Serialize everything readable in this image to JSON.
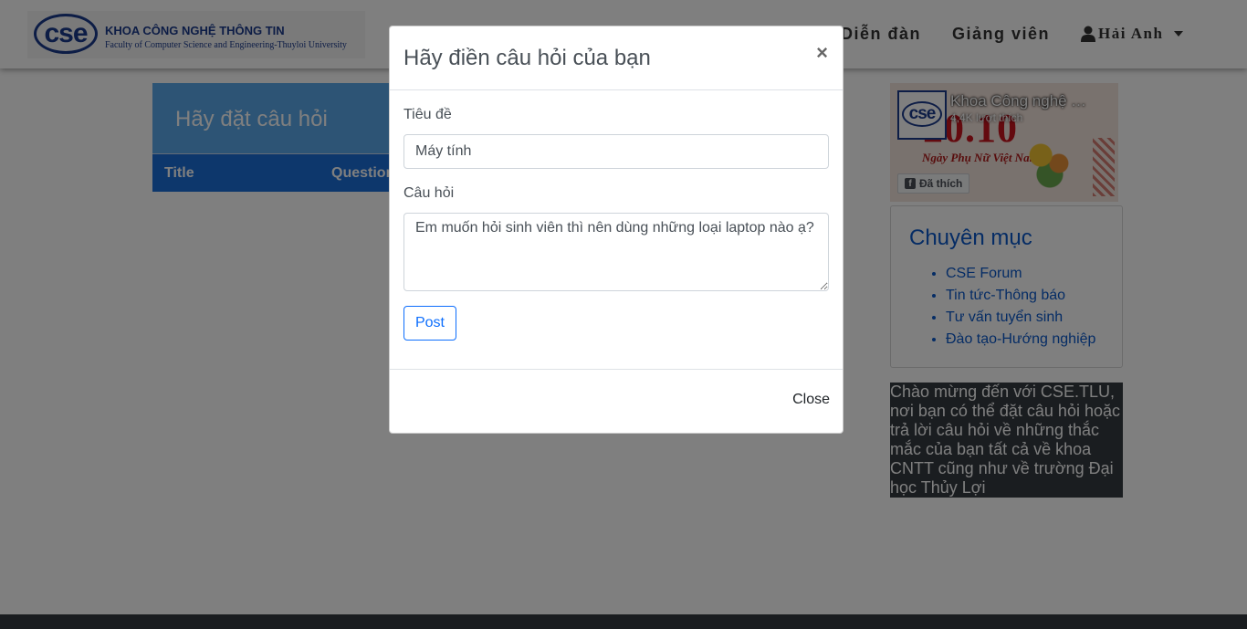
{
  "navbar": {
    "logo": {
      "mark": "cse",
      "line1": "KHOA CÔNG NGHỆ THÔNG TIN",
      "line2": "Faculty of Computer Science and Engineering-Thuyloi University"
    },
    "links": [
      "Diễn đàn",
      "Giảng viên"
    ],
    "user_name": "Hải Anh",
    "user_icon": "user-icon",
    "dropdown_icon": "caret-down-icon"
  },
  "main": {
    "header": "Hãy đặt câu hỏi",
    "table_columns": [
      "Title",
      "Question"
    ]
  },
  "sidebar": {
    "facebook": {
      "page_name": "Khoa Công nghệ Thông tin",
      "likes": "4,4K lượt thích",
      "like_button": "Đã thích",
      "cover_text": "20.10",
      "cover_subtitle": "Ngày Phụ Nữ Việt Nam",
      "avatar_mark": "cse",
      "button_icon": "facebook-icon"
    },
    "categories": {
      "title": "Chuyên mục",
      "items": [
        "CSE Forum",
        "Tin tức-Thông báo",
        "Tư vấn tuyển sinh",
        "Đào tạo-Hướng nghiệp"
      ]
    },
    "welcome": "Chào mừng đến với CSE.TLU, nơi bạn có thể đặt câu hỏi hoặc trả lời câu hỏi về những thắc mắc của bạn tất cả về khoa CNTT cũng như về trường Đại học Thủy Lợi"
  },
  "modal": {
    "title": "Hãy điền câu hỏi của bạn",
    "close_symbol": "×",
    "title_label": "Tiêu đề",
    "title_value": "Máy tính",
    "question_label": "Câu hỏi",
    "question_value": "Em muốn hỏi sinh viên thì nên dùng những loại laptop nào ạ?",
    "post_button": "Post",
    "close_button": "Close"
  },
  "colors": {
    "primary": "#0d6efd",
    "header_blue": "#5aa9ea",
    "table_blue": "#1a6fd8",
    "dark": "#343a40"
  }
}
